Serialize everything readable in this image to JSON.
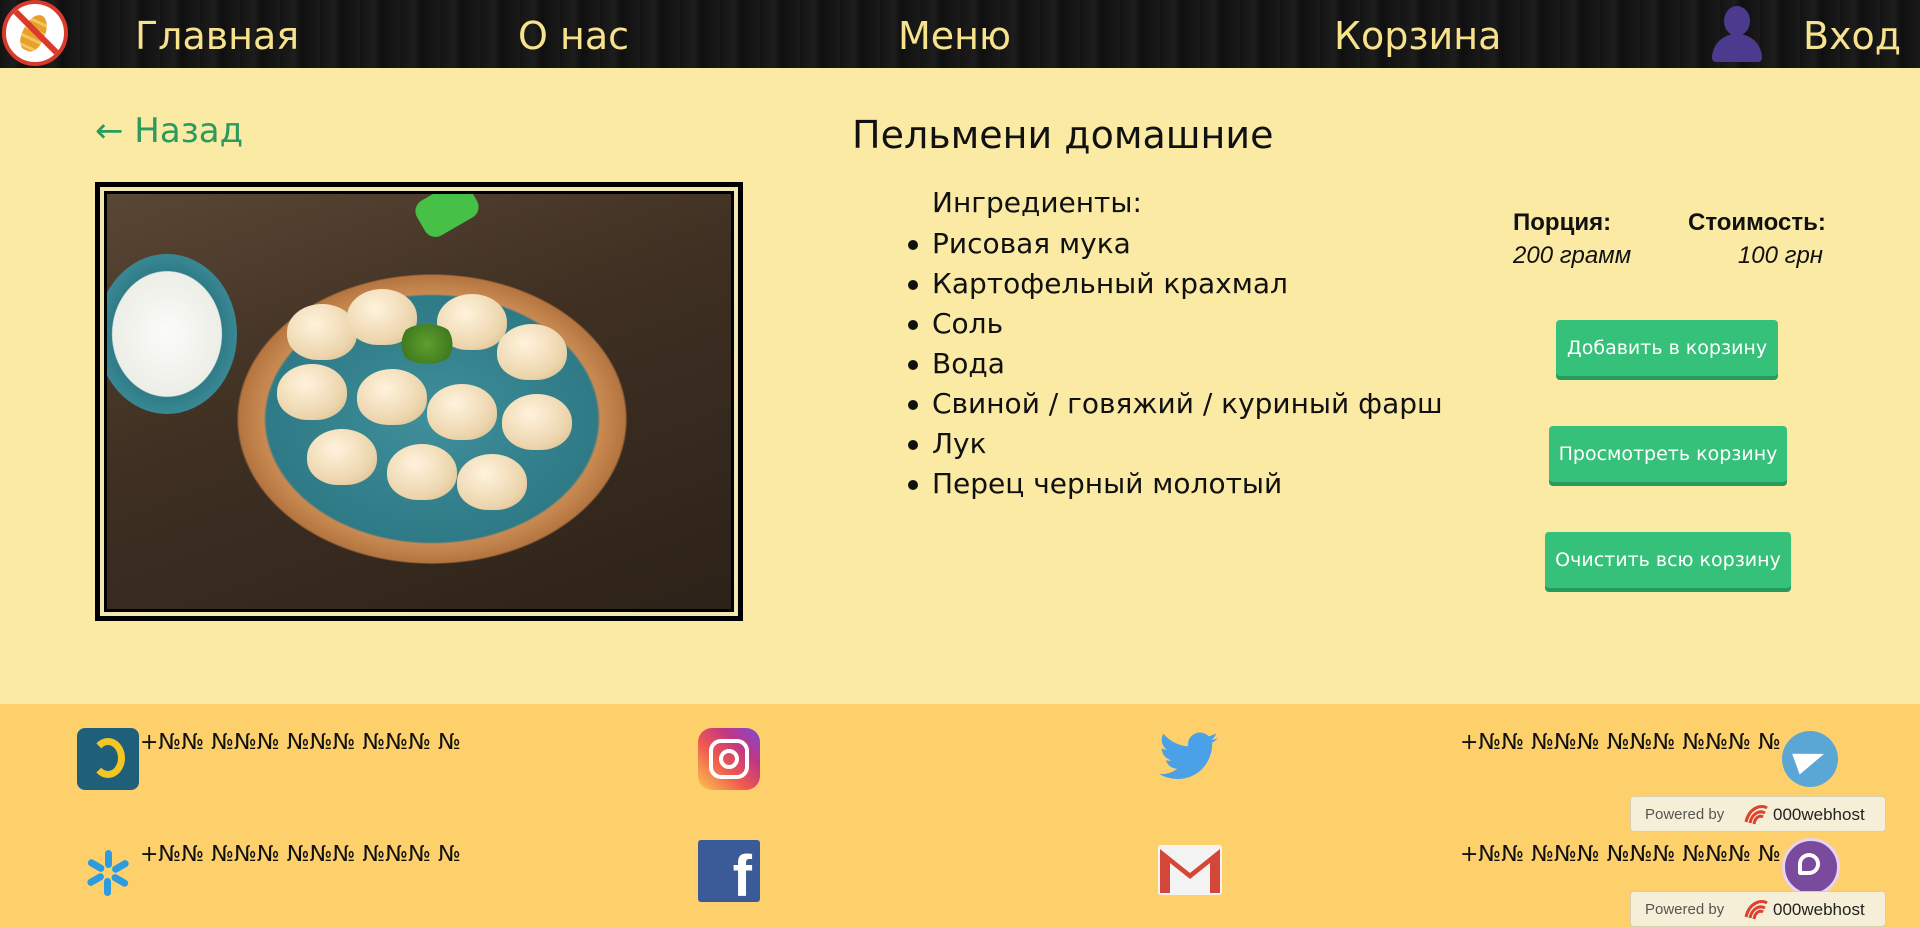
{
  "nav": {
    "items": [
      "Главная",
      "О нас",
      "Меню",
      "Корзина"
    ],
    "login": "Вход"
  },
  "back_link": "← Назад",
  "dish": {
    "title": "Пельмени домашние",
    "ingredients_title": "Ингредиенты:",
    "ingredients": [
      "Рисовая мука",
      "Картофельный крахмал",
      "Соль",
      "Вода",
      "Свиной / говяжий / куриный фарш",
      "Лук",
      "Перец черный молотый"
    ],
    "portion_label": "Порция:",
    "portion_value": "200 грамм",
    "cost_label": "Стоимость:",
    "cost_value": "100 грн"
  },
  "buttons": {
    "add": "Добавить в корзину",
    "view": "Просмотреть корзину",
    "clear": "Очистить всю корзину"
  },
  "footer": {
    "phone_lifecell": "+№№ №№№ №№№ №№№ №",
    "phone_kyivstar": "+№№ №№№ №№№ №№№ №",
    "phone_telegram": "+№№ №№№ №№№ №№№ №",
    "phone_viber": "+№№ №№№ №№№ №№№ №",
    "powered_text": "Powered by",
    "powered_brand": "000webhost",
    "facebook_letter": "f"
  },
  "colors": {
    "page_bg": "#faeaa4",
    "nav_text": "#f7e38d",
    "accent_green": "#36c17a",
    "link_green": "#2b9a5f",
    "footer_bg": "#fdd06b"
  },
  "icons": [
    "no-wheat-logo-icon",
    "user-icon",
    "lifecell-icon",
    "kyivstar-icon",
    "instagram-icon",
    "facebook-icon",
    "twitter-icon",
    "gmail-icon",
    "telegram-icon",
    "viber-icon",
    "webhost-logo-icon"
  ]
}
